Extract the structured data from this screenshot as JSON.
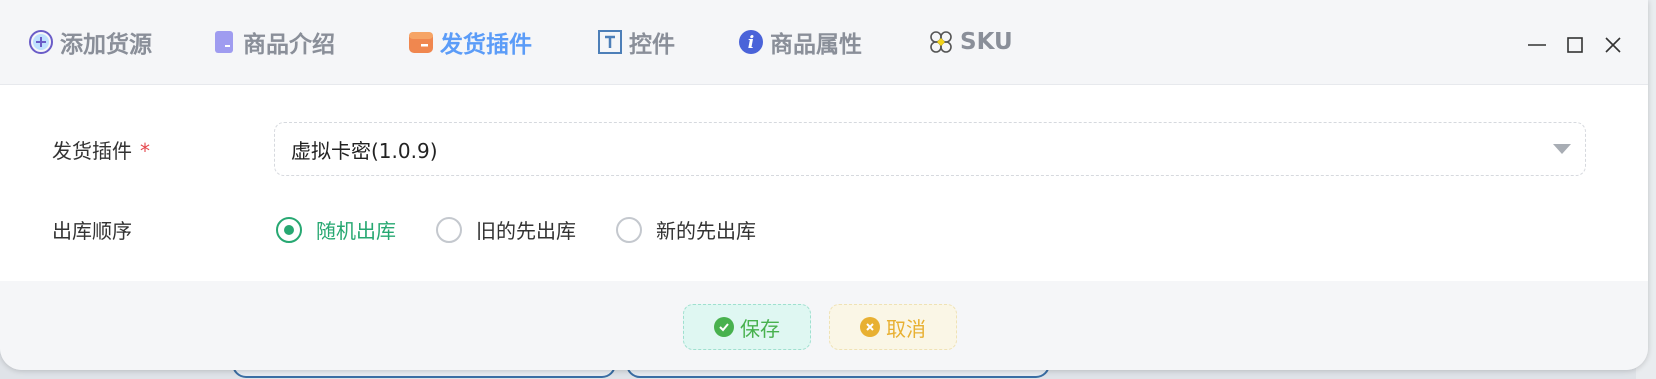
{
  "tabs": [
    {
      "label": "添加货源",
      "icon": "plus-circle-icon",
      "active": false
    },
    {
      "label": "商品介绍",
      "icon": "bookmark-icon",
      "active": false
    },
    {
      "label": "发货插件",
      "icon": "package-icon",
      "active": true
    },
    {
      "label": "控件",
      "icon": "text-box-icon",
      "active": false
    },
    {
      "label": "商品属性",
      "icon": "info-icon",
      "active": false
    },
    {
      "label": "SKU",
      "icon": "clover-icon",
      "active": false
    }
  ],
  "window_controls": [
    "minimize-icon",
    "maximize-icon",
    "close-icon"
  ],
  "form": {
    "plugin": {
      "label": "发货插件",
      "required_mark": "*",
      "value": "虚拟卡密(1.0.9)"
    },
    "order": {
      "label": "出库顺序",
      "options": [
        {
          "label": "随机出库",
          "checked": true
        },
        {
          "label": "旧的先出库",
          "checked": false
        },
        {
          "label": "新的先出库",
          "checked": false
        }
      ]
    }
  },
  "actions": {
    "save_label": "保存",
    "cancel_label": "取消"
  },
  "colors": {
    "active_tab": "#5b9cf8",
    "radio_checked": "#27a872",
    "save": "#48b14e",
    "cancel": "#e8b032",
    "required": "#e5484d"
  }
}
